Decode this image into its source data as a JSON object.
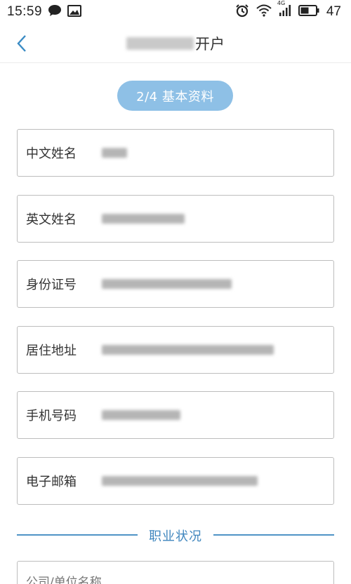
{
  "status_bar": {
    "time": "15:59",
    "battery_level": "47",
    "network": "4G",
    "icons": [
      "chat-bubble-icon",
      "image-icon",
      "alarm-clock-icon",
      "wifi-icon",
      "signal-icon",
      "battery-icon"
    ]
  },
  "nav": {
    "title_suffix": "开户",
    "back_icon": "chevron-left-icon"
  },
  "step": {
    "label": "2/4 基本资料"
  },
  "fields": [
    {
      "label": "中文姓名"
    },
    {
      "label": "英文姓名"
    },
    {
      "label": "身份证号"
    },
    {
      "label": "居住地址"
    },
    {
      "label": "手机号码"
    },
    {
      "label": "电子邮箱"
    }
  ],
  "section": {
    "title": "职业状况"
  },
  "company_field": {
    "placeholder": "公司/单位名称"
  },
  "colors": {
    "accent": "#4f93c6",
    "pill_background": "#8ec0e6",
    "field_border": "#bdbdbd"
  }
}
